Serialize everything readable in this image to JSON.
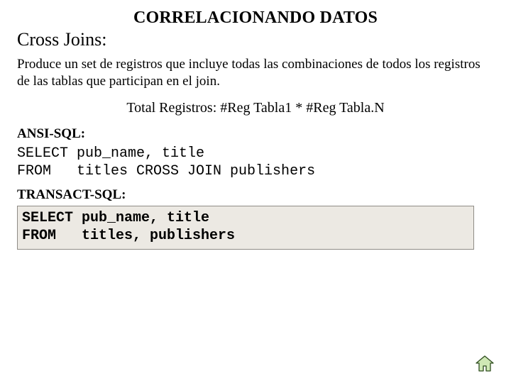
{
  "title": "CORRELACIONANDO DATOS",
  "subtitle": "Cross Joins:",
  "description": "Produce un set de registros que incluye todas las combinaciones de todos los registros de las tablas que participan en el join.",
  "total_line": "Total Registros: #Reg Tabla1 * #Reg Tabla.N",
  "ansi_label": "ANSI-SQL:",
  "ansi_code": "SELECT pub_name, title\nFROM   titles CROSS JOIN publishers",
  "tsql_label": "TRANSACT-SQL:",
  "tsql_code": "SELECT pub_name, title\nFROM   titles, publishers",
  "icons": {
    "home": "home-icon"
  },
  "colors": {
    "box_bg": "#ece9e3",
    "box_border": "#8f8c86"
  }
}
